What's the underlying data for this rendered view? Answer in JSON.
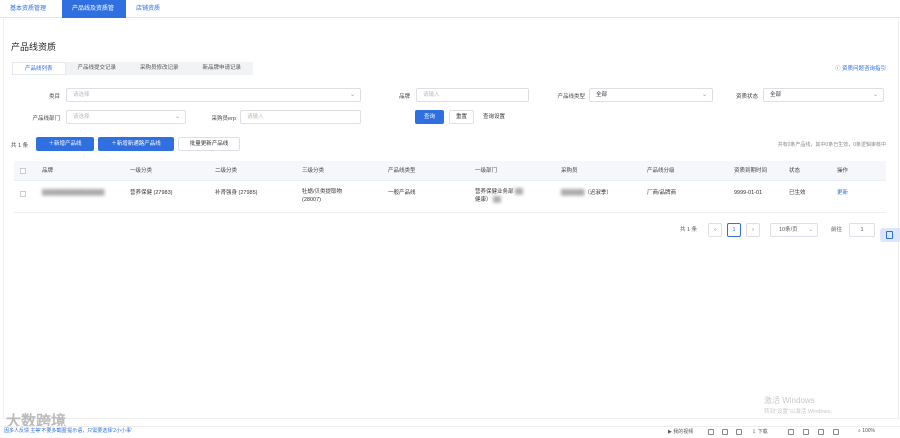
{
  "topnav": {
    "tabs": [
      {
        "label": "基本资质管理",
        "active": false
      },
      {
        "label": "产品线及资质管理",
        "active": true
      },
      {
        "label": "店铺资质",
        "active": false
      }
    ]
  },
  "page": {
    "title": "产品线资质",
    "guide_link": "资质问题咨询指引"
  },
  "subtabs": [
    {
      "label": "产品线列表",
      "active": true
    },
    {
      "label": "产品线提交记录",
      "active": false
    },
    {
      "label": "采购员修改记录",
      "active": false
    },
    {
      "label": "新品牌申请记录",
      "active": false
    }
  ],
  "filters": {
    "category": {
      "label": "类目",
      "placeholder": "请选择"
    },
    "brand": {
      "label": "品牌",
      "placeholder": "请输入"
    },
    "line_type": {
      "label": "产品线类型",
      "value": "全部"
    },
    "qual_status": {
      "label": "资质状态",
      "value": "全部"
    },
    "dept": {
      "label": "产品线部门",
      "placeholder": "请选择"
    },
    "buyer_erp": {
      "label": "采购员erp",
      "placeholder": "请输入"
    }
  },
  "actions": {
    "search": "查询",
    "reset": "重置",
    "query_settings": "查询设置",
    "add_line": "新增产品线",
    "add_cross_border_line": "新增新通路产品线",
    "batch_update": "批量更新产品线"
  },
  "list": {
    "total": "共 1 条",
    "summary": "共有0条产品线，其中0条已生效，0条逻辑审核中",
    "columns": [
      "品牌",
      "一级分类",
      "二级分类",
      "三级分类",
      "产品线类型",
      "一级部门",
      "采购员",
      "产品线分级",
      "资质到期时间",
      "状态",
      "操作"
    ],
    "rows": [
      {
        "brand": "████████████████",
        "cat1": "营养保健 (27983)",
        "cat2": "补肾强身 (27985)",
        "cat3_line1": "牡蛎/贝类提取物",
        "cat3_line2": "(28007)",
        "line_type": "一般产品线",
        "dept_line1": "营养保健业务部",
        "dept_line2": "健康）",
        "buyer_name": "（迟淑季）",
        "grade": "厂商/品牌商",
        "expiry": "9999-01-01",
        "status": "已生效",
        "op": "更新"
      }
    ]
  },
  "pagination": {
    "total": "共 1 条",
    "prev": "‹",
    "current": "1",
    "next": "›",
    "page_size": "10条/页",
    "goto_label": "前往",
    "goto_value": "1"
  },
  "system": {
    "activate_title": "激活 Windows",
    "activate_sub": "转到\"设置\"以激活 Windows。",
    "brand_watermark": "大数跨境",
    "notice": "因多人反馈 主等'不要多截图'提示语，只需要选择'2小小事'",
    "tray_video": "我的视频",
    "tray_download": "下载",
    "zoom": "100%"
  },
  "colors": {
    "accent": "#2f6fe0",
    "header_bg": "#f5f7fa"
  }
}
